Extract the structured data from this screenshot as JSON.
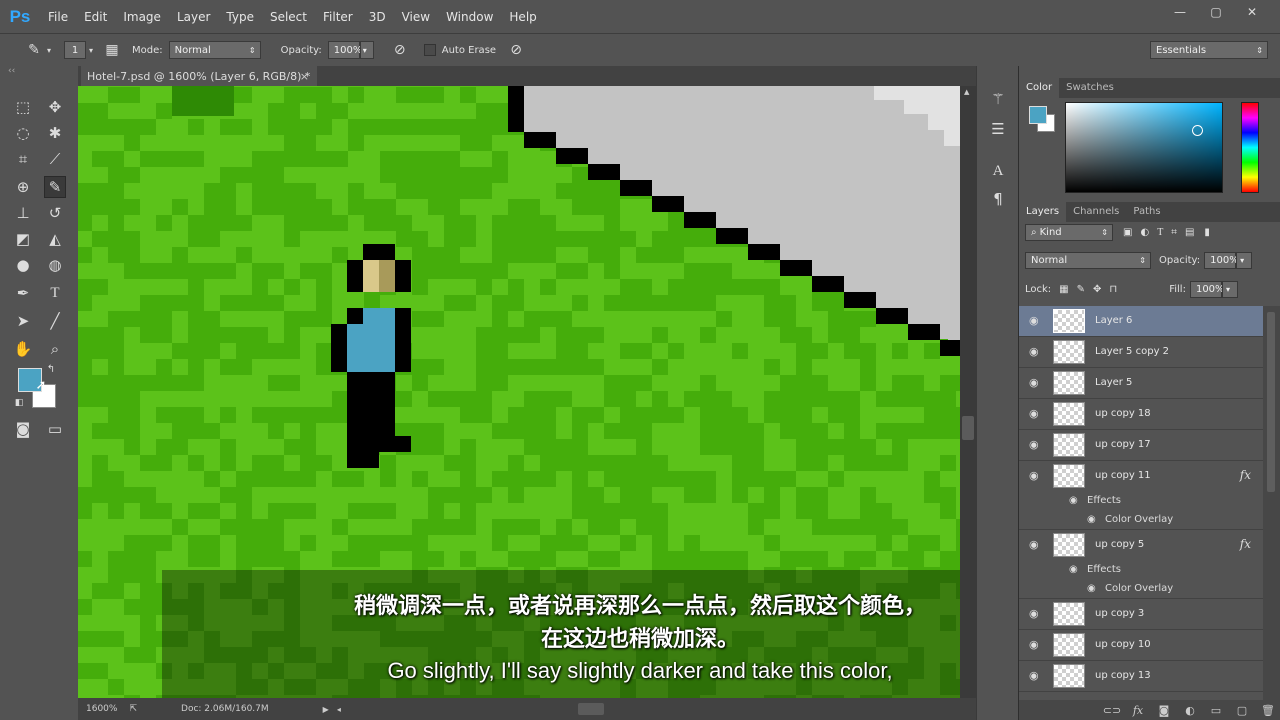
{
  "app": {
    "logo": "Ps"
  },
  "menu": [
    "File",
    "Edit",
    "Image",
    "Layer",
    "Type",
    "Select",
    "Filter",
    "3D",
    "View",
    "Window",
    "Help"
  ],
  "window_controls": {
    "minimize": "—",
    "restore": "▢",
    "close": "✕"
  },
  "options_bar": {
    "brush_size": "1",
    "mode_label": "Mode:",
    "mode_value": "Normal",
    "opacity_label": "Opacity:",
    "opacity_value": "100%",
    "auto_erase_label": "Auto Erase",
    "workspace": "Essentials"
  },
  "document": {
    "tab_title": "Hotel-7.psd @ 1600% (Layer 6, RGB/8) *",
    "close": "×",
    "zoom": "1600%",
    "doc_size": "Doc: 2.06M/160.7M"
  },
  "subtitles": {
    "zh_line1": "稍微调深一点，或者说再深那么一点点，然后取这个颜色，",
    "zh_line2": "在这边也稍微加深。",
    "en_line": "Go slightly, I'll say slightly darker and take this color,"
  },
  "color_panel": {
    "tabs": [
      "Color",
      "Swatches"
    ],
    "foreground": "#4ba3c3",
    "background": "#ffffff"
  },
  "layers_panel": {
    "tabs": [
      "Layers",
      "Channels",
      "Paths"
    ],
    "filter_kind": "Kind",
    "blend_mode": "Normal",
    "opacity_label": "Opacity:",
    "opacity_value": "100%",
    "lock_label": "Lock:",
    "fill_label": "Fill:",
    "fill_value": "100%",
    "layers": [
      {
        "name": "Layer 6",
        "selected": true
      },
      {
        "name": "Layer 5 copy 2"
      },
      {
        "name": "Layer 5"
      },
      {
        "name": "up copy 18"
      },
      {
        "name": "up copy 17"
      },
      {
        "name": "up copy 11",
        "fx": "fx",
        "effects_label": "Effects",
        "effect": "Color Overlay"
      },
      {
        "name": "up copy 5",
        "fx": "fx",
        "effects_label": "Effects",
        "effect": "Color Overlay"
      },
      {
        "name": "up copy 3"
      },
      {
        "name": "up copy 10"
      },
      {
        "name": "up copy 13"
      }
    ]
  },
  "colors": {
    "grass_light": "#5cc21a",
    "grass_dark": "#45ad0b",
    "grass_deep": "#2e8a05",
    "sky": "#c3c3c3",
    "outline": "#000000",
    "shirt": "#4ba3c3",
    "face_light": "#d9c88a",
    "face_dark": "#a89a5a"
  }
}
